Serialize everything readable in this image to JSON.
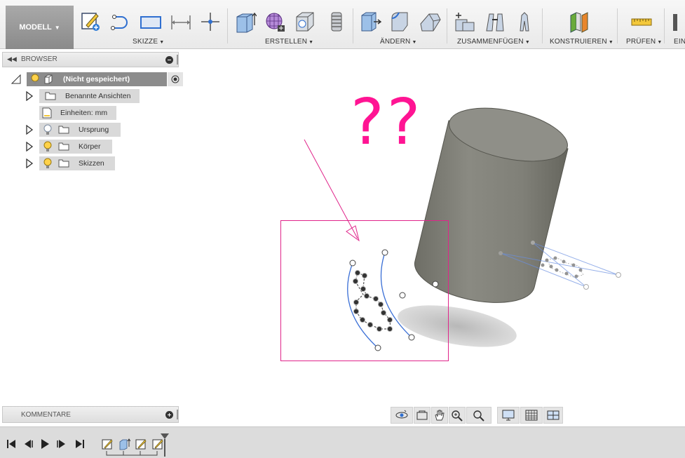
{
  "toolbar": {
    "workspace": "MODELL",
    "groups": [
      {
        "label": "SKIZZE"
      },
      {
        "label": "ERSTELLEN"
      },
      {
        "label": "ÄNDERN"
      },
      {
        "label": "ZUSAMMENFÜGEN"
      },
      {
        "label": "KONSTRUIEREN"
      },
      {
        "label": "PRÜFEN"
      },
      {
        "label": "EIN"
      }
    ]
  },
  "browser": {
    "title": "BROWSER",
    "root": "(Nicht gespeichert)",
    "items": [
      {
        "label": "Benannte Ansichten"
      },
      {
        "label": "Einheiten: mm"
      },
      {
        "label": "Ursprung"
      },
      {
        "label": "Körper"
      },
      {
        "label": "Skizzen"
      }
    ]
  },
  "comments": {
    "title": "KOMMENTARE"
  },
  "annotation": {
    "text": "??",
    "color": "#ff1493"
  },
  "colors": {
    "accent": "#ff1493",
    "body": "#8a8a80",
    "sketch": "#3a6fd6"
  }
}
